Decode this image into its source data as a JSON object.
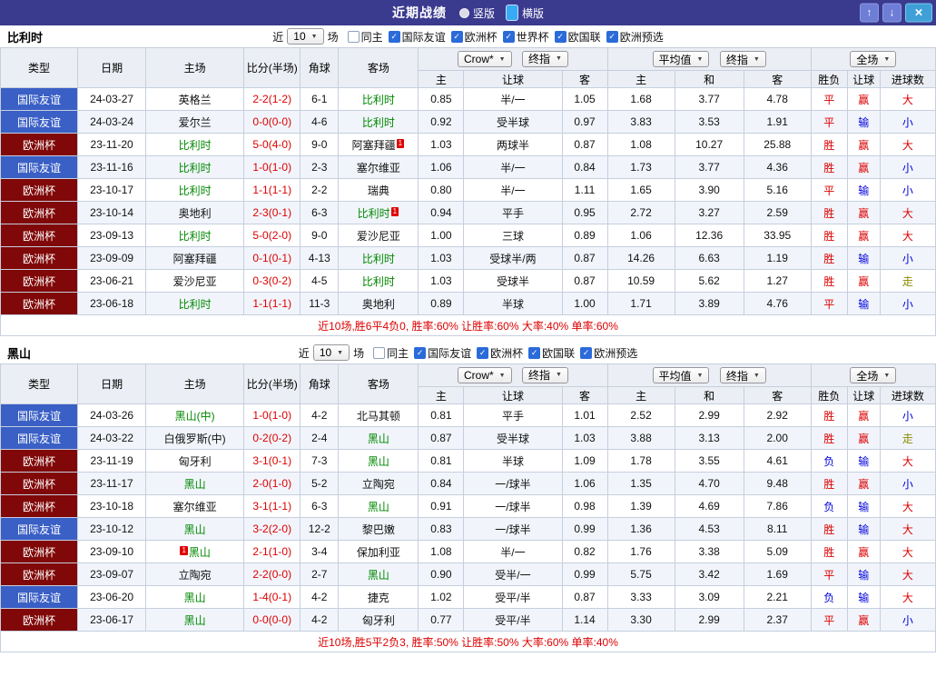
{
  "title_bar": {
    "title": "近期战绩",
    "radios": [
      {
        "label": "竖版",
        "selected": false
      },
      {
        "label": "横版",
        "selected": true
      }
    ]
  },
  "icons": {
    "dropdown_caret": "▼",
    "up_arrow": "↑",
    "down_arrow": "↓",
    "close": "×",
    "checkmark": "✓"
  },
  "filter_labels": {
    "near": "近",
    "games": "场"
  },
  "columns": {
    "type": "类型",
    "date": "日期",
    "home": "主场",
    "score": "比分(半场)",
    "corners": "角球",
    "away": "客场",
    "odds_group": {
      "select1": "Crow*",
      "select2": "终指",
      "subs": [
        "主",
        "让球",
        "客"
      ]
    },
    "avg_group": {
      "select1": "平均值",
      "select2": "终指",
      "subs": [
        "主",
        "和",
        "客"
      ]
    },
    "full_group": {
      "select1": "全场",
      "subs": [
        "胜负",
        "让球",
        "进球数"
      ]
    }
  },
  "colors": {
    "titlebar_bg": "#3a3a8f",
    "button_blue": "#6e7ed6",
    "close_blue": "#3fa0d8",
    "check_blue": "#2b6bd9",
    "friendly_blue": "#3a5fc5",
    "euro_maroon": "#800808",
    "win_red": "#dd0000",
    "lose_blue": "#0000dd",
    "push_olive": "#8a8a00",
    "team_green": "#008800"
  },
  "sections": [
    {
      "team": "比利时",
      "filters": {
        "count": "10",
        "checkboxes": [
          {
            "label": "同主",
            "checked": false
          },
          {
            "label": "国际友谊",
            "checked": true
          },
          {
            "label": "欧洲杯",
            "checked": true
          },
          {
            "label": "世界杯",
            "checked": true
          },
          {
            "label": "欧国联",
            "checked": true
          },
          {
            "label": "欧洲预选",
            "checked": true
          }
        ]
      },
      "rows": [
        {
          "comp": "国际友谊",
          "comp_type": "friendly",
          "date": "24-03-27",
          "home": {
            "text": "英格兰"
          },
          "score": "2-2(1-2)",
          "corners": "6-1",
          "away": {
            "text": "比利时",
            "highlight": true
          },
          "odds": [
            "0.85",
            "半/一",
            "1.05"
          ],
          "avg": [
            "1.68",
            "3.77",
            "4.78"
          ],
          "results": [
            {
              "text": "平",
              "color": "red"
            },
            {
              "text": "赢",
              "color": "red"
            },
            {
              "text": "大",
              "color": "red"
            }
          ]
        },
        {
          "comp": "国际友谊",
          "comp_type": "friendly",
          "date": "24-03-24",
          "home": {
            "text": "爱尔兰"
          },
          "score": "0-0(0-0)",
          "corners": "4-6",
          "away": {
            "text": "比利时",
            "highlight": true
          },
          "odds": [
            "0.92",
            "受半球",
            "0.97"
          ],
          "avg": [
            "3.83",
            "3.53",
            "1.91"
          ],
          "results": [
            {
              "text": "平",
              "color": "red"
            },
            {
              "text": "输",
              "color": "blue"
            },
            {
              "text": "小",
              "color": "blue"
            }
          ]
        },
        {
          "comp": "欧洲杯",
          "comp_type": "euro",
          "date": "23-11-20",
          "home": {
            "text": "比利时",
            "highlight": true
          },
          "score": "5-0(4-0)",
          "corners": "9-0",
          "away": {
            "text": "阿塞拜疆",
            "card_after": "1"
          },
          "odds": [
            "1.03",
            "两球半",
            "0.87"
          ],
          "avg": [
            "1.08",
            "10.27",
            "25.88"
          ],
          "results": [
            {
              "text": "胜",
              "color": "red"
            },
            {
              "text": "赢",
              "color": "red"
            },
            {
              "text": "大",
              "color": "red"
            }
          ]
        },
        {
          "comp": "国际友谊",
          "comp_type": "friendly",
          "date": "23-11-16",
          "home": {
            "text": "比利时",
            "highlight": true
          },
          "score": "1-0(1-0)",
          "corners": "2-3",
          "away": {
            "text": "塞尔维亚"
          },
          "odds": [
            "1.06",
            "半/一",
            "0.84"
          ],
          "avg": [
            "1.73",
            "3.77",
            "4.36"
          ],
          "results": [
            {
              "text": "胜",
              "color": "red"
            },
            {
              "text": "赢",
              "color": "red"
            },
            {
              "text": "小",
              "color": "blue"
            }
          ]
        },
        {
          "comp": "欧洲杯",
          "comp_type": "euro",
          "date": "23-10-17",
          "home": {
            "text": "比利时",
            "highlight": true
          },
          "score": "1-1(1-1)",
          "corners": "2-2",
          "away": {
            "text": "瑞典"
          },
          "odds": [
            "0.80",
            "半/一",
            "1.11"
          ],
          "avg": [
            "1.65",
            "3.90",
            "5.16"
          ],
          "results": [
            {
              "text": "平",
              "color": "red"
            },
            {
              "text": "输",
              "color": "blue"
            },
            {
              "text": "小",
              "color": "blue"
            }
          ]
        },
        {
          "comp": "欧洲杯",
          "comp_type": "euro",
          "date": "23-10-14",
          "home": {
            "text": "奥地利"
          },
          "score": "2-3(0-1)",
          "corners": "6-3",
          "away": {
            "text": "比利时",
            "highlight": true,
            "card_after": "1"
          },
          "odds": [
            "0.94",
            "平手",
            "0.95"
          ],
          "avg": [
            "2.72",
            "3.27",
            "2.59"
          ],
          "results": [
            {
              "text": "胜",
              "color": "red"
            },
            {
              "text": "赢",
              "color": "red"
            },
            {
              "text": "大",
              "color": "red"
            }
          ]
        },
        {
          "comp": "欧洲杯",
          "comp_type": "euro",
          "date": "23-09-13",
          "home": {
            "text": "比利时",
            "highlight": true
          },
          "score": "5-0(2-0)",
          "corners": "9-0",
          "away": {
            "text": "爱沙尼亚"
          },
          "odds": [
            "1.00",
            "三球",
            "0.89"
          ],
          "avg": [
            "1.06",
            "12.36",
            "33.95"
          ],
          "results": [
            {
              "text": "胜",
              "color": "red"
            },
            {
              "text": "赢",
              "color": "red"
            },
            {
              "text": "大",
              "color": "red"
            }
          ]
        },
        {
          "comp": "欧洲杯",
          "comp_type": "euro",
          "date": "23-09-09",
          "home": {
            "text": "阿塞拜疆"
          },
          "score": "0-1(0-1)",
          "corners": "4-13",
          "away": {
            "text": "比利时",
            "highlight": true
          },
          "odds": [
            "1.03",
            "受球半/两",
            "0.87"
          ],
          "avg": [
            "14.26",
            "6.63",
            "1.19"
          ],
          "results": [
            {
              "text": "胜",
              "color": "red"
            },
            {
              "text": "输",
              "color": "blue"
            },
            {
              "text": "小",
              "color": "blue"
            }
          ]
        },
        {
          "comp": "欧洲杯",
          "comp_type": "euro",
          "date": "23-06-21",
          "home": {
            "text": "爱沙尼亚"
          },
          "score": "0-3(0-2)",
          "corners": "4-5",
          "away": {
            "text": "比利时",
            "highlight": true
          },
          "odds": [
            "1.03",
            "受球半",
            "0.87"
          ],
          "avg": [
            "10.59",
            "5.62",
            "1.27"
          ],
          "results": [
            {
              "text": "胜",
              "color": "red"
            },
            {
              "text": "赢",
              "color": "red"
            },
            {
              "text": "走",
              "color": "walk"
            }
          ]
        },
        {
          "comp": "欧洲杯",
          "comp_type": "euro",
          "date": "23-06-18",
          "home": {
            "text": "比利时",
            "highlight": true
          },
          "score": "1-1(1-1)",
          "corners": "11-3",
          "away": {
            "text": "奥地利"
          },
          "odds": [
            "0.89",
            "半球",
            "1.00"
          ],
          "avg": [
            "1.71",
            "3.89",
            "4.76"
          ],
          "results": [
            {
              "text": "平",
              "color": "red"
            },
            {
              "text": "输",
              "color": "blue"
            },
            {
              "text": "小",
              "color": "blue"
            }
          ]
        }
      ],
      "summary": "近10场,胜6平4负0, 胜率:60% 让胜率:60% 大率:40% 单率:60%"
    },
    {
      "team": "黑山",
      "filters": {
        "count": "10",
        "checkboxes": [
          {
            "label": "同主",
            "checked": false
          },
          {
            "label": "国际友谊",
            "checked": true
          },
          {
            "label": "欧洲杯",
            "checked": true
          },
          {
            "label": "欧国联",
            "checked": true
          },
          {
            "label": "欧洲预选",
            "checked": true
          }
        ]
      },
      "rows": [
        {
          "comp": "国际友谊",
          "comp_type": "friendly",
          "date": "24-03-26",
          "home": {
            "text": "黑山(中)",
            "highlight": true
          },
          "score": "1-0(1-0)",
          "corners": "4-2",
          "away": {
            "text": "北马其顿"
          },
          "odds": [
            "0.81",
            "平手",
            "1.01"
          ],
          "avg": [
            "2.52",
            "2.99",
            "2.92"
          ],
          "results": [
            {
              "text": "胜",
              "color": "red"
            },
            {
              "text": "赢",
              "color": "red"
            },
            {
              "text": "小",
              "color": "blue"
            }
          ]
        },
        {
          "comp": "国际友谊",
          "comp_type": "friendly",
          "date": "24-03-22",
          "home": {
            "text": "白俄罗斯(中)"
          },
          "score": "0-2(0-2)",
          "corners": "2-4",
          "away": {
            "text": "黑山",
            "highlight": true
          },
          "odds": [
            "0.87",
            "受半球",
            "1.03"
          ],
          "avg": [
            "3.88",
            "3.13",
            "2.00"
          ],
          "results": [
            {
              "text": "胜",
              "color": "red"
            },
            {
              "text": "赢",
              "color": "red"
            },
            {
              "text": "走",
              "color": "walk"
            }
          ]
        },
        {
          "comp": "欧洲杯",
          "comp_type": "euro",
          "date": "23-11-19",
          "home": {
            "text": "匈牙利"
          },
          "score": "3-1(0-1)",
          "corners": "7-3",
          "away": {
            "text": "黑山",
            "highlight": true
          },
          "odds": [
            "0.81",
            "半球",
            "1.09"
          ],
          "avg": [
            "1.78",
            "3.55",
            "4.61"
          ],
          "results": [
            {
              "text": "负",
              "color": "blue"
            },
            {
              "text": "输",
              "color": "blue"
            },
            {
              "text": "大",
              "color": "red"
            }
          ]
        },
        {
          "comp": "欧洲杯",
          "comp_type": "euro",
          "date": "23-11-17",
          "home": {
            "text": "黑山",
            "highlight": true
          },
          "score": "2-0(1-0)",
          "corners": "5-2",
          "away": {
            "text": "立陶宛"
          },
          "odds": [
            "0.84",
            "一/球半",
            "1.06"
          ],
          "avg": [
            "1.35",
            "4.70",
            "9.48"
          ],
          "results": [
            {
              "text": "胜",
              "color": "red"
            },
            {
              "text": "赢",
              "color": "red"
            },
            {
              "text": "小",
              "color": "blue"
            }
          ]
        },
        {
          "comp": "欧洲杯",
          "comp_type": "euro",
          "date": "23-10-18",
          "home": {
            "text": "塞尔维亚"
          },
          "score": "3-1(1-1)",
          "corners": "6-3",
          "away": {
            "text": "黑山",
            "highlight": true
          },
          "odds": [
            "0.91",
            "一/球半",
            "0.98"
          ],
          "avg": [
            "1.39",
            "4.69",
            "7.86"
          ],
          "results": [
            {
              "text": "负",
              "color": "blue"
            },
            {
              "text": "输",
              "color": "blue"
            },
            {
              "text": "大",
              "color": "red"
            }
          ]
        },
        {
          "comp": "国际友谊",
          "comp_type": "friendly",
          "date": "23-10-12",
          "home": {
            "text": "黑山",
            "highlight": true
          },
          "score": "3-2(2-0)",
          "corners": "12-2",
          "away": {
            "text": "黎巴嫩"
          },
          "odds": [
            "0.83",
            "一/球半",
            "0.99"
          ],
          "avg": [
            "1.36",
            "4.53",
            "8.11"
          ],
          "results": [
            {
              "text": "胜",
              "color": "red"
            },
            {
              "text": "输",
              "color": "blue"
            },
            {
              "text": "大",
              "color": "red"
            }
          ]
        },
        {
          "comp": "欧洲杯",
          "comp_type": "euro",
          "date": "23-09-10",
          "home": {
            "text": "黑山",
            "highlight": true,
            "card_before": "1"
          },
          "score": "2-1(1-0)",
          "corners": "3-4",
          "away": {
            "text": "保加利亚"
          },
          "odds": [
            "1.08",
            "半/一",
            "0.82"
          ],
          "avg": [
            "1.76",
            "3.38",
            "5.09"
          ],
          "results": [
            {
              "text": "胜",
              "color": "red"
            },
            {
              "text": "赢",
              "color": "red"
            },
            {
              "text": "大",
              "color": "red"
            }
          ]
        },
        {
          "comp": "欧洲杯",
          "comp_type": "euro",
          "date": "23-09-07",
          "home": {
            "text": "立陶宛"
          },
          "score": "2-2(0-0)",
          "corners": "2-7",
          "away": {
            "text": "黑山",
            "highlight": true
          },
          "odds": [
            "0.90",
            "受半/一",
            "0.99"
          ],
          "avg": [
            "5.75",
            "3.42",
            "1.69"
          ],
          "results": [
            {
              "text": "平",
              "color": "red"
            },
            {
              "text": "输",
              "color": "blue"
            },
            {
              "text": "大",
              "color": "red"
            }
          ]
        },
        {
          "comp": "国际友谊",
          "comp_type": "friendly",
          "date": "23-06-20",
          "home": {
            "text": "黑山",
            "highlight": true
          },
          "score": "1-4(0-1)",
          "corners": "4-2",
          "away": {
            "text": "捷克"
          },
          "odds": [
            "1.02",
            "受平/半",
            "0.87"
          ],
          "avg": [
            "3.33",
            "3.09",
            "2.21"
          ],
          "results": [
            {
              "text": "负",
              "color": "blue"
            },
            {
              "text": "输",
              "color": "blue"
            },
            {
              "text": "大",
              "color": "red"
            }
          ]
        },
        {
          "comp": "欧洲杯",
          "comp_type": "euro",
          "date": "23-06-17",
          "home": {
            "text": "黑山",
            "highlight": true
          },
          "score": "0-0(0-0)",
          "corners": "4-2",
          "away": {
            "text": "匈牙利"
          },
          "odds": [
            "0.77",
            "受平/半",
            "1.14"
          ],
          "avg": [
            "3.30",
            "2.99",
            "2.37"
          ],
          "results": [
            {
              "text": "平",
              "color": "red"
            },
            {
              "text": "赢",
              "color": "red"
            },
            {
              "text": "小",
              "color": "blue"
            }
          ]
        }
      ],
      "summary": "近10场,胜5平2负3, 胜率:50% 让胜率:50% 大率:60% 单率:40%"
    }
  ]
}
